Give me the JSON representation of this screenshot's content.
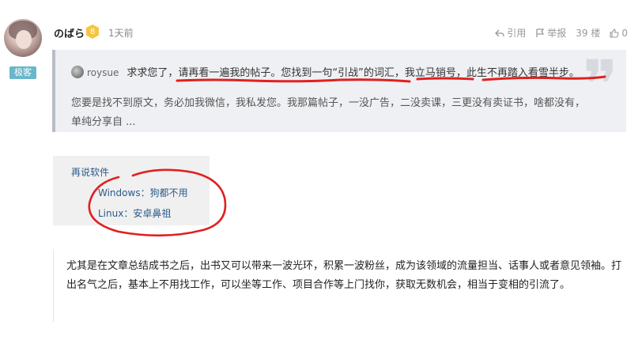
{
  "post": {
    "username": "のばら",
    "level": "8",
    "role": "极客",
    "time": "1天前",
    "actions": {
      "quote": "引用",
      "report": "举报",
      "floor": "39 楼",
      "likes": "0"
    }
  },
  "quote": {
    "user": "roysue",
    "line1": "求求您了，请再看一遍我的帖子。您找到一句“引战”的词汇，我立马销号，此生不再踏入看雪半步。",
    "line2": "您要是找不到原文，务必加我微信，我私发您。我那篇帖子，一没广告，二没卖课，三更没有卖证书，啥都没有，单纯分享自 ..."
  },
  "code_box": {
    "title": "再说软件",
    "item1": "Windows：狗都不用",
    "item2": "Linux：安卓鼻祖"
  },
  "paragraph": "尤其是在文章总结成书之后，出书又可以带来一波光环，积累一波粉丝，成为该领域的流量担当、话事人或者意见领袖。打出名气之后，基本上不用找工作，可以坐等工作、项目合作等上门找你，获取无数机会，相当于变相的引流了。",
  "colors": {
    "annotation": "#e02020",
    "badge": "#69b7c9",
    "level": "#f5c542",
    "link": "#2a5c8a"
  }
}
